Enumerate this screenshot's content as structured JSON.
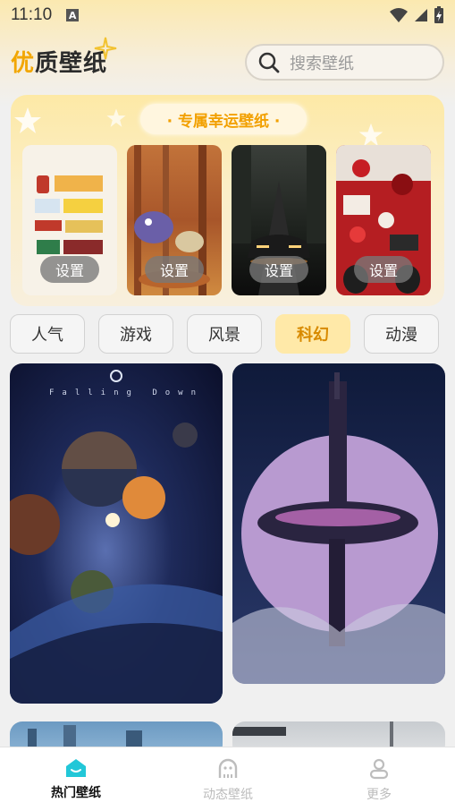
{
  "status_bar": {
    "time": "11:10",
    "notification_letter": "A"
  },
  "header": {
    "title_accent": "优",
    "title_rest": "质壁纸",
    "search_placeholder": "搜索壁纸"
  },
  "lucky": {
    "title": "· 专属幸运壁纸 ·",
    "items": [
      {
        "set_label": "设置",
        "subject": "retro-signs"
      },
      {
        "set_label": "设置",
        "subject": "forest-creatures"
      },
      {
        "set_label": "设置",
        "subject": "sports-car"
      },
      {
        "set_label": "设置",
        "subject": "red-collage"
      }
    ]
  },
  "categories": [
    {
      "label": "人气",
      "active": false
    },
    {
      "label": "游戏",
      "active": false
    },
    {
      "label": "风景",
      "active": false
    },
    {
      "label": "科幻",
      "active": true
    },
    {
      "label": "动漫",
      "active": false
    }
  ],
  "wallpapers": [
    {
      "subject": "planets-space",
      "overlay_text": "Falling Down"
    },
    {
      "subject": "space-station-planet"
    },
    {
      "subject": "sci-fi-city"
    },
    {
      "subject": "foggy-tower"
    }
  ],
  "bottom_nav": [
    {
      "label": "热门壁纸",
      "icon": "home-icon",
      "active": true
    },
    {
      "label": "动态壁纸",
      "icon": "ghost-icon",
      "active": false
    },
    {
      "label": "更多",
      "icon": "person-icon",
      "active": false
    }
  ],
  "colors": {
    "accent": "#f2a600",
    "active_tab_bg": "#ffe9a8",
    "nav_active_icon": "#22c7d8"
  }
}
